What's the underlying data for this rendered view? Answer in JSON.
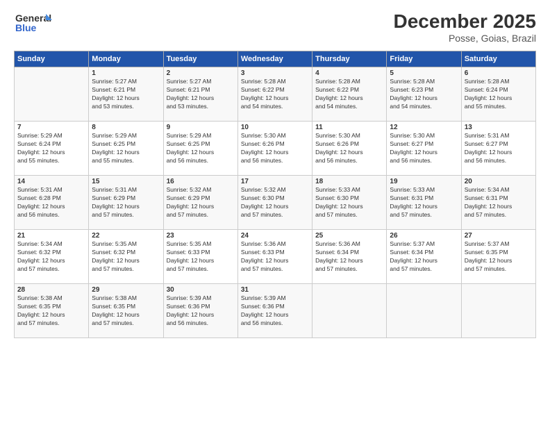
{
  "logo": {
    "line1": "General",
    "line2": "Blue"
  },
  "title": "December 2025",
  "subtitle": "Posse, Goias, Brazil",
  "headers": [
    "Sunday",
    "Monday",
    "Tuesday",
    "Wednesday",
    "Thursday",
    "Friday",
    "Saturday"
  ],
  "weeks": [
    [
      {
        "day": "",
        "info": ""
      },
      {
        "day": "1",
        "info": "Sunrise: 5:27 AM\nSunset: 6:21 PM\nDaylight: 12 hours\nand 53 minutes."
      },
      {
        "day": "2",
        "info": "Sunrise: 5:27 AM\nSunset: 6:21 PM\nDaylight: 12 hours\nand 53 minutes."
      },
      {
        "day": "3",
        "info": "Sunrise: 5:28 AM\nSunset: 6:22 PM\nDaylight: 12 hours\nand 54 minutes."
      },
      {
        "day": "4",
        "info": "Sunrise: 5:28 AM\nSunset: 6:22 PM\nDaylight: 12 hours\nand 54 minutes."
      },
      {
        "day": "5",
        "info": "Sunrise: 5:28 AM\nSunset: 6:23 PM\nDaylight: 12 hours\nand 54 minutes."
      },
      {
        "day": "6",
        "info": "Sunrise: 5:28 AM\nSunset: 6:24 PM\nDaylight: 12 hours\nand 55 minutes."
      }
    ],
    [
      {
        "day": "7",
        "info": "Sunrise: 5:29 AM\nSunset: 6:24 PM\nDaylight: 12 hours\nand 55 minutes."
      },
      {
        "day": "8",
        "info": "Sunrise: 5:29 AM\nSunset: 6:25 PM\nDaylight: 12 hours\nand 55 minutes."
      },
      {
        "day": "9",
        "info": "Sunrise: 5:29 AM\nSunset: 6:25 PM\nDaylight: 12 hours\nand 56 minutes."
      },
      {
        "day": "10",
        "info": "Sunrise: 5:30 AM\nSunset: 6:26 PM\nDaylight: 12 hours\nand 56 minutes."
      },
      {
        "day": "11",
        "info": "Sunrise: 5:30 AM\nSunset: 6:26 PM\nDaylight: 12 hours\nand 56 minutes."
      },
      {
        "day": "12",
        "info": "Sunrise: 5:30 AM\nSunset: 6:27 PM\nDaylight: 12 hours\nand 56 minutes."
      },
      {
        "day": "13",
        "info": "Sunrise: 5:31 AM\nSunset: 6:27 PM\nDaylight: 12 hours\nand 56 minutes."
      }
    ],
    [
      {
        "day": "14",
        "info": "Sunrise: 5:31 AM\nSunset: 6:28 PM\nDaylight: 12 hours\nand 56 minutes."
      },
      {
        "day": "15",
        "info": "Sunrise: 5:31 AM\nSunset: 6:29 PM\nDaylight: 12 hours\nand 57 minutes."
      },
      {
        "day": "16",
        "info": "Sunrise: 5:32 AM\nSunset: 6:29 PM\nDaylight: 12 hours\nand 57 minutes."
      },
      {
        "day": "17",
        "info": "Sunrise: 5:32 AM\nSunset: 6:30 PM\nDaylight: 12 hours\nand 57 minutes."
      },
      {
        "day": "18",
        "info": "Sunrise: 5:33 AM\nSunset: 6:30 PM\nDaylight: 12 hours\nand 57 minutes."
      },
      {
        "day": "19",
        "info": "Sunrise: 5:33 AM\nSunset: 6:31 PM\nDaylight: 12 hours\nand 57 minutes."
      },
      {
        "day": "20",
        "info": "Sunrise: 5:34 AM\nSunset: 6:31 PM\nDaylight: 12 hours\nand 57 minutes."
      }
    ],
    [
      {
        "day": "21",
        "info": "Sunrise: 5:34 AM\nSunset: 6:32 PM\nDaylight: 12 hours\nand 57 minutes."
      },
      {
        "day": "22",
        "info": "Sunrise: 5:35 AM\nSunset: 6:32 PM\nDaylight: 12 hours\nand 57 minutes."
      },
      {
        "day": "23",
        "info": "Sunrise: 5:35 AM\nSunset: 6:33 PM\nDaylight: 12 hours\nand 57 minutes."
      },
      {
        "day": "24",
        "info": "Sunrise: 5:36 AM\nSunset: 6:33 PM\nDaylight: 12 hours\nand 57 minutes."
      },
      {
        "day": "25",
        "info": "Sunrise: 5:36 AM\nSunset: 6:34 PM\nDaylight: 12 hours\nand 57 minutes."
      },
      {
        "day": "26",
        "info": "Sunrise: 5:37 AM\nSunset: 6:34 PM\nDaylight: 12 hours\nand 57 minutes."
      },
      {
        "day": "27",
        "info": "Sunrise: 5:37 AM\nSunset: 6:35 PM\nDaylight: 12 hours\nand 57 minutes."
      }
    ],
    [
      {
        "day": "28",
        "info": "Sunrise: 5:38 AM\nSunset: 6:35 PM\nDaylight: 12 hours\nand 57 minutes."
      },
      {
        "day": "29",
        "info": "Sunrise: 5:38 AM\nSunset: 6:35 PM\nDaylight: 12 hours\nand 57 minutes."
      },
      {
        "day": "30",
        "info": "Sunrise: 5:39 AM\nSunset: 6:36 PM\nDaylight: 12 hours\nand 56 minutes."
      },
      {
        "day": "31",
        "info": "Sunrise: 5:39 AM\nSunset: 6:36 PM\nDaylight: 12 hours\nand 56 minutes."
      },
      {
        "day": "",
        "info": ""
      },
      {
        "day": "",
        "info": ""
      },
      {
        "day": "",
        "info": ""
      }
    ]
  ]
}
